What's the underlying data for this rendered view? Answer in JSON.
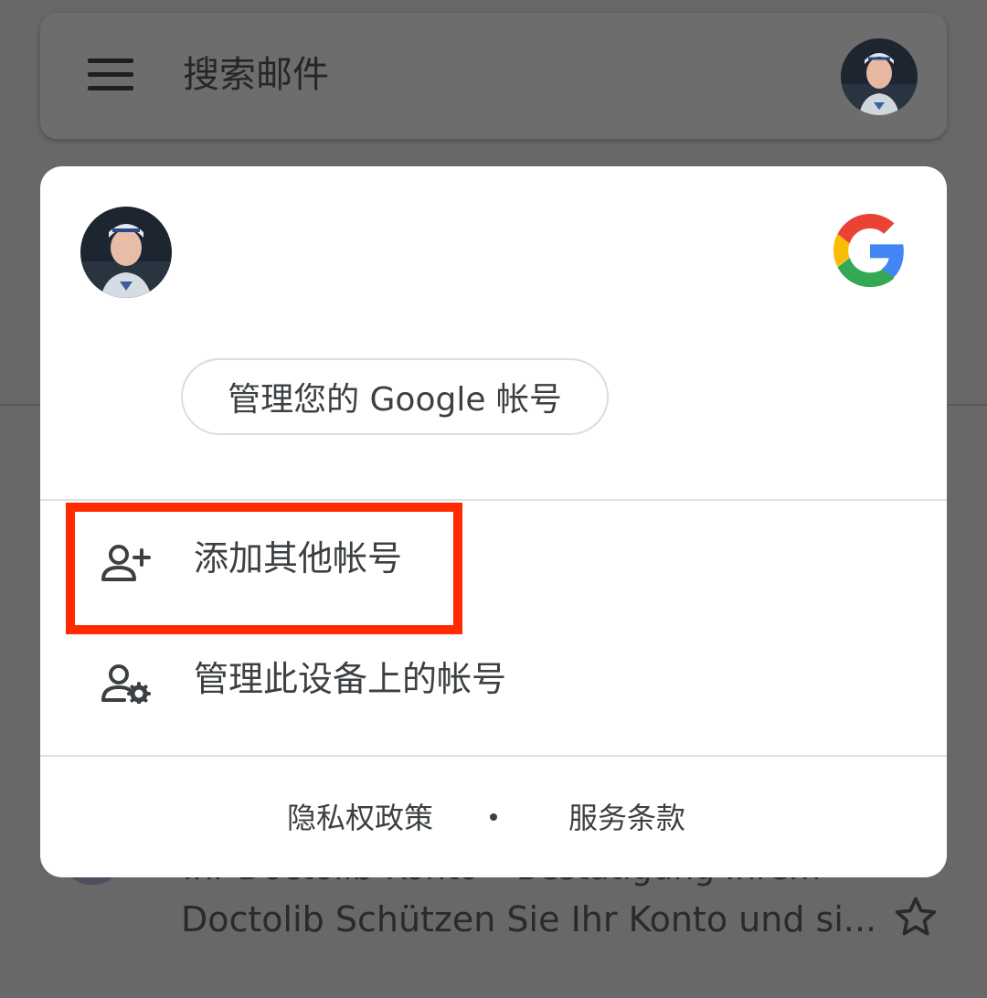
{
  "search_bar": {
    "placeholder": "搜索邮件"
  },
  "account_card": {
    "manage_account_label": "管理您的 Google 帐号",
    "menu": [
      {
        "label": "添加其他帐号",
        "icon": "add-person-icon"
      },
      {
        "label": "管理此设备上的帐号",
        "icon": "manage-accounts-icon"
      }
    ],
    "footer": {
      "privacy_label": "隐私权政策",
      "terms_label": "服务条款"
    }
  },
  "background_email": {
    "sender_line": "Ihr Doctolib-Konto – Bestätigung Ihrem",
    "snippet": "Doctolib Schützen Sie Ihr Konto und si..."
  },
  "colors": {
    "highlight": "#ff2a00",
    "scrim": "#686868",
    "google_blue": "#4285F4",
    "google_red": "#EA4335",
    "google_yellow": "#FBBC05",
    "google_green": "#34A853"
  }
}
